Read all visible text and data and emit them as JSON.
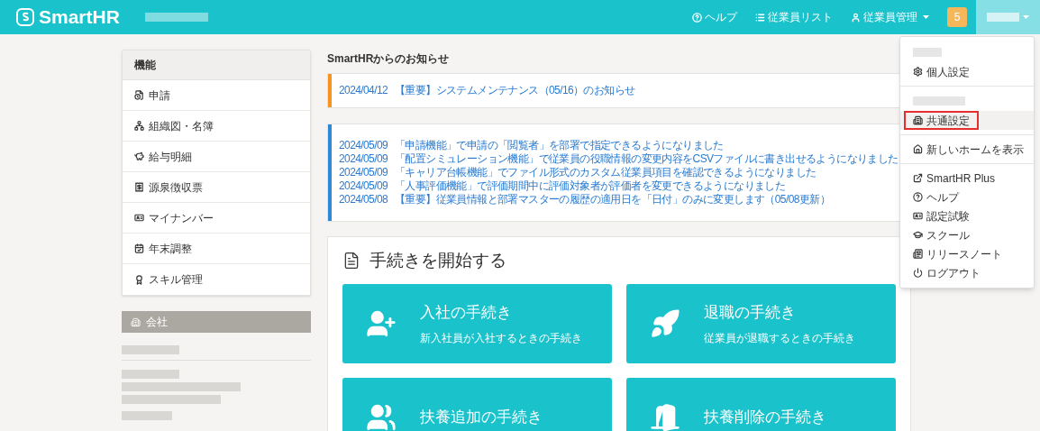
{
  "header": {
    "logo": "SmartHR",
    "nav": [
      {
        "label": "ヘルプ",
        "kind": "help"
      },
      {
        "label": "従業員リスト",
        "kind": "list"
      },
      {
        "label": "従業員管理",
        "kind": "menu"
      }
    ],
    "badge": "5",
    "user_menu_open": true
  },
  "sidebar": {
    "title": "機能",
    "items": [
      {
        "label": "申請"
      },
      {
        "label": "組織図・名簿"
      },
      {
        "label": "給与明細"
      },
      {
        "label": "源泉徴収票"
      },
      {
        "label": "マイナンバー"
      },
      {
        "label": "年末調整"
      },
      {
        "label": "スキル管理"
      }
    ],
    "company_title": "会社"
  },
  "notices": {
    "title": "SmartHRからのお知らせ",
    "groups": [
      {
        "color": "#f7941d",
        "items": [
          {
            "date": "2024/04/12",
            "text": "【重要】システムメンテナンス（05/16）のお知らせ"
          }
        ]
      },
      {
        "color": "#2d88d6",
        "items": [
          {
            "date": "2024/05/09",
            "text": "「申請機能」で申請の「閲覧者」を部署で指定できるようになりました"
          },
          {
            "date": "2024/05/09",
            "text": "「配置シミュレーション機能」で従業員の役職情報の変更内容をCSVファイルに書き出せるようになりました"
          },
          {
            "date": "2024/05/09",
            "text": "「キャリア台帳機能」でファイル形式のカスタム従業員項目を確認できるようになりました"
          },
          {
            "date": "2024/05/09",
            "text": "「人事評価機能」で評価期間中に評価対象者が評価者を変更できるようになりました"
          },
          {
            "date": "2024/05/08",
            "text": "【重要】従業員情報と部署マスターの履歴の適用日を「日付」のみに変更します（05/08更新）"
          }
        ]
      }
    ]
  },
  "procedures": {
    "title": "手続きを開始する",
    "cards": [
      {
        "title": "入社の手続き",
        "subtitle": "新入社員が入社するときの手続き"
      },
      {
        "title": "退職の手続き",
        "subtitle": "従業員が退職するときの手続き"
      },
      {
        "title": "扶養追加の手続き"
      },
      {
        "title": "扶養削除の手続き"
      }
    ]
  },
  "user_menu": {
    "sections": [
      {
        "redacted_header": true,
        "items": [
          {
            "label": "個人設定",
            "selected": false
          }
        ]
      },
      {
        "redacted_header": true,
        "items": [
          {
            "label": "共通設定",
            "selected": true
          }
        ]
      },
      {
        "redacted_header": false,
        "items": [
          {
            "label": "新しいホームを表示",
            "selected": false
          }
        ]
      },
      {
        "redacted_header": false,
        "items": [
          {
            "label": "SmartHR Plus",
            "selected": false
          },
          {
            "label": "ヘルプ",
            "selected": false
          },
          {
            "label": "認定試験",
            "selected": false
          },
          {
            "label": "スクール",
            "selected": false
          },
          {
            "label": "リリースノート",
            "selected": false
          },
          {
            "label": "ログアウト",
            "selected": false
          }
        ]
      }
    ]
  }
}
